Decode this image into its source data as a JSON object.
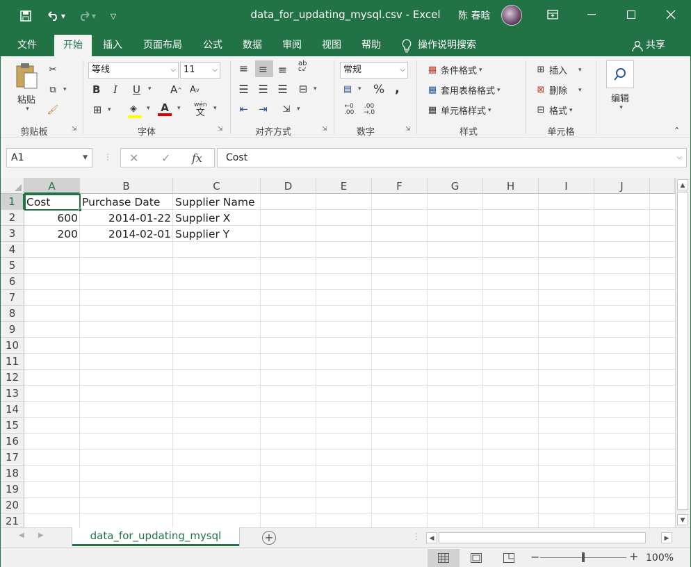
{
  "window": {
    "title": "data_for_updating_mysql.csv  -  Excel",
    "user_name": "陈 春晗",
    "controls": {
      "ribbon_display": "⧉",
      "minimize": "—",
      "maximize": "☐",
      "close": "✕"
    }
  },
  "quick_access": {
    "save": "save",
    "undo": "undo",
    "redo": "redo",
    "customize": "customize"
  },
  "ribbon_tabs": [
    {
      "label": "文件",
      "active": false
    },
    {
      "label": "开始",
      "active": true
    },
    {
      "label": "插入",
      "active": false
    },
    {
      "label": "页面布局",
      "active": false
    },
    {
      "label": "公式",
      "active": false
    },
    {
      "label": "数据",
      "active": false
    },
    {
      "label": "审阅",
      "active": false
    },
    {
      "label": "视图",
      "active": false
    },
    {
      "label": "帮助",
      "active": false
    }
  ],
  "tell_me": "操作说明搜索",
  "share": "共享",
  "ribbon": {
    "clipboard": {
      "label": "剪贴板",
      "paste": "粘贴"
    },
    "font": {
      "label": "字体",
      "font_name": "等线",
      "font_size": "11",
      "bold": "B",
      "italic": "I",
      "underline": "U",
      "grow": "A",
      "shrink": "A",
      "font_color": "A",
      "phonetic": "wén"
    },
    "alignment": {
      "label": "对齐方式"
    },
    "number": {
      "label": "数字",
      "format": "常规",
      "percent": "%",
      "comma": ","
    },
    "styles": {
      "label": "样式",
      "conditional": "条件格式",
      "table": "套用表格格式",
      "cell_styles": "单元格样式"
    },
    "cells": {
      "label": "单元格",
      "insert": "插入",
      "delete": "删除",
      "format": "格式"
    },
    "editing": {
      "label": "编辑"
    }
  },
  "formula_bar": {
    "name_box": "A1",
    "content": "Cost",
    "fx": "fx"
  },
  "columns": [
    "A",
    "B",
    "C",
    "D",
    "E",
    "F",
    "G",
    "H",
    "I",
    "J"
  ],
  "rows": [
    "1",
    "2",
    "3",
    "4",
    "5",
    "6",
    "7",
    "8",
    "9",
    "10",
    "11",
    "12",
    "13",
    "14",
    "15",
    "16",
    "17",
    "18",
    "19",
    "20",
    "21"
  ],
  "cells": {
    "A1": "Cost",
    "B1": "Purchase Date",
    "C1": "Supplier Name",
    "A2": "600",
    "B2": "2014-01-22",
    "C2": "Supplier X",
    "A3": "200",
    "B3": "2014-02-01",
    "C3": "Supplier Y"
  },
  "sheet_tab": "data_for_updating_mysql",
  "status": {
    "zoom": "100%"
  },
  "colors": {
    "accent": "#217346"
  }
}
